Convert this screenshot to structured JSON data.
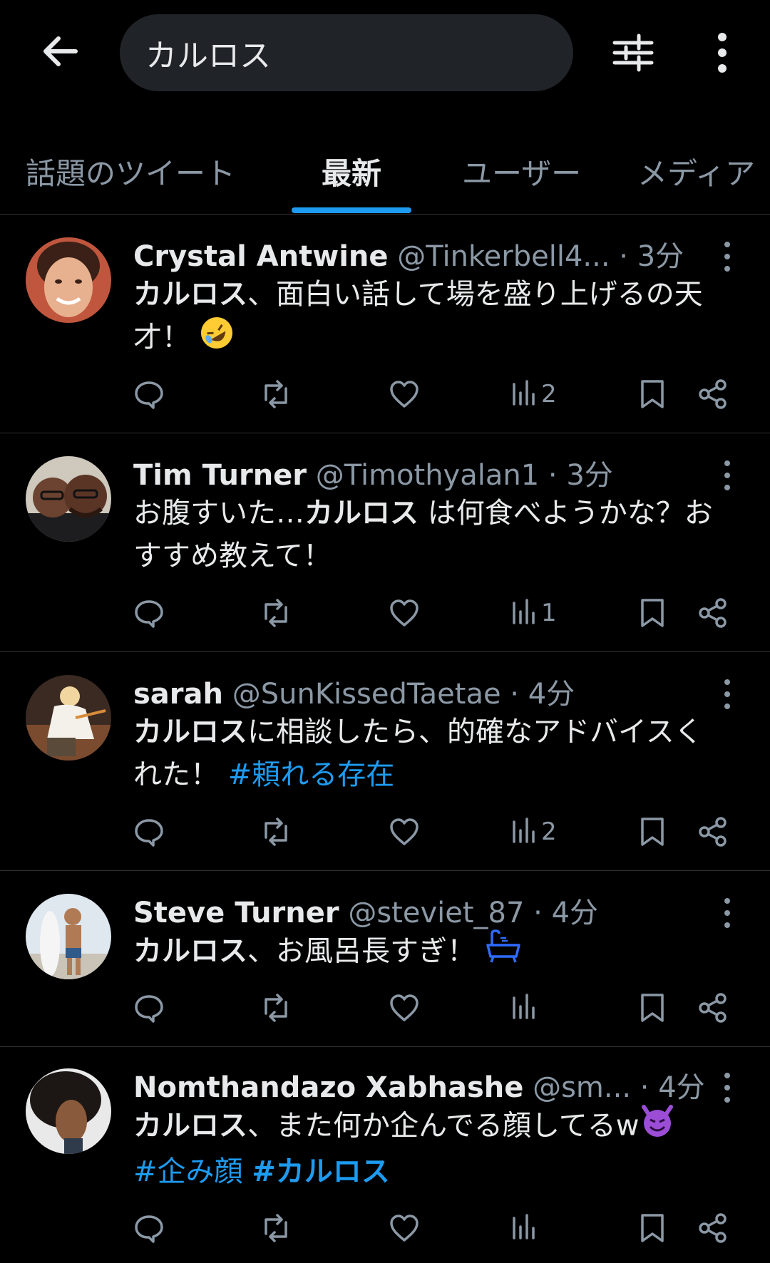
{
  "search": {
    "query": "カルロス"
  },
  "tabs": [
    {
      "label": "話題のツイート",
      "active": false
    },
    {
      "label": "最新",
      "active": true
    },
    {
      "label": "ユーザー",
      "active": false
    },
    {
      "label": "メディア",
      "active": false
    }
  ],
  "posts": [
    {
      "name": "Crystal Antwine",
      "handle": "@Tinkerbell4...",
      "time": "3分",
      "keyword": "カルロス",
      "text": "、面白い話して場を盛り上げるの天才！",
      "emoji": "rolling-laughing",
      "views": "2"
    },
    {
      "name": "Tim Turner",
      "handle": "@Timothyalan1",
      "time": "3分",
      "pre": "お腹すいた…",
      "keyword": "カルロス",
      "text": " は何食べようかな？おすすめ教えて！",
      "views": "1"
    },
    {
      "name": "sarah",
      "handle": "@SunKissedTaetae",
      "time": "4分",
      "keyword": "カルロス",
      "text": "に相談したら、的確なアドバイスくれた！ ",
      "hashtags": [
        "#頼れる存在"
      ],
      "views": "2"
    },
    {
      "name": "Steve Turner",
      "handle": "@steviet_87",
      "time": "4分",
      "keyword": "カルロス",
      "text": "、お風呂長すぎ！",
      "emoji": "bathtub",
      "views": ""
    },
    {
      "name": "Nomthandazo Xabhashe",
      "handle": "@sm...",
      "time": "4分",
      "keyword": "カルロス",
      "text": "、また何か企んでる顔してるw",
      "emoji": "smiling-devil",
      "hashtags": [
        "#企み顔",
        "#カルロス"
      ],
      "views": ""
    }
  ],
  "dot": "·",
  "colors": {
    "accent": "#1d9bf0",
    "bg": "#000000",
    "muted": "#8b98a5"
  }
}
